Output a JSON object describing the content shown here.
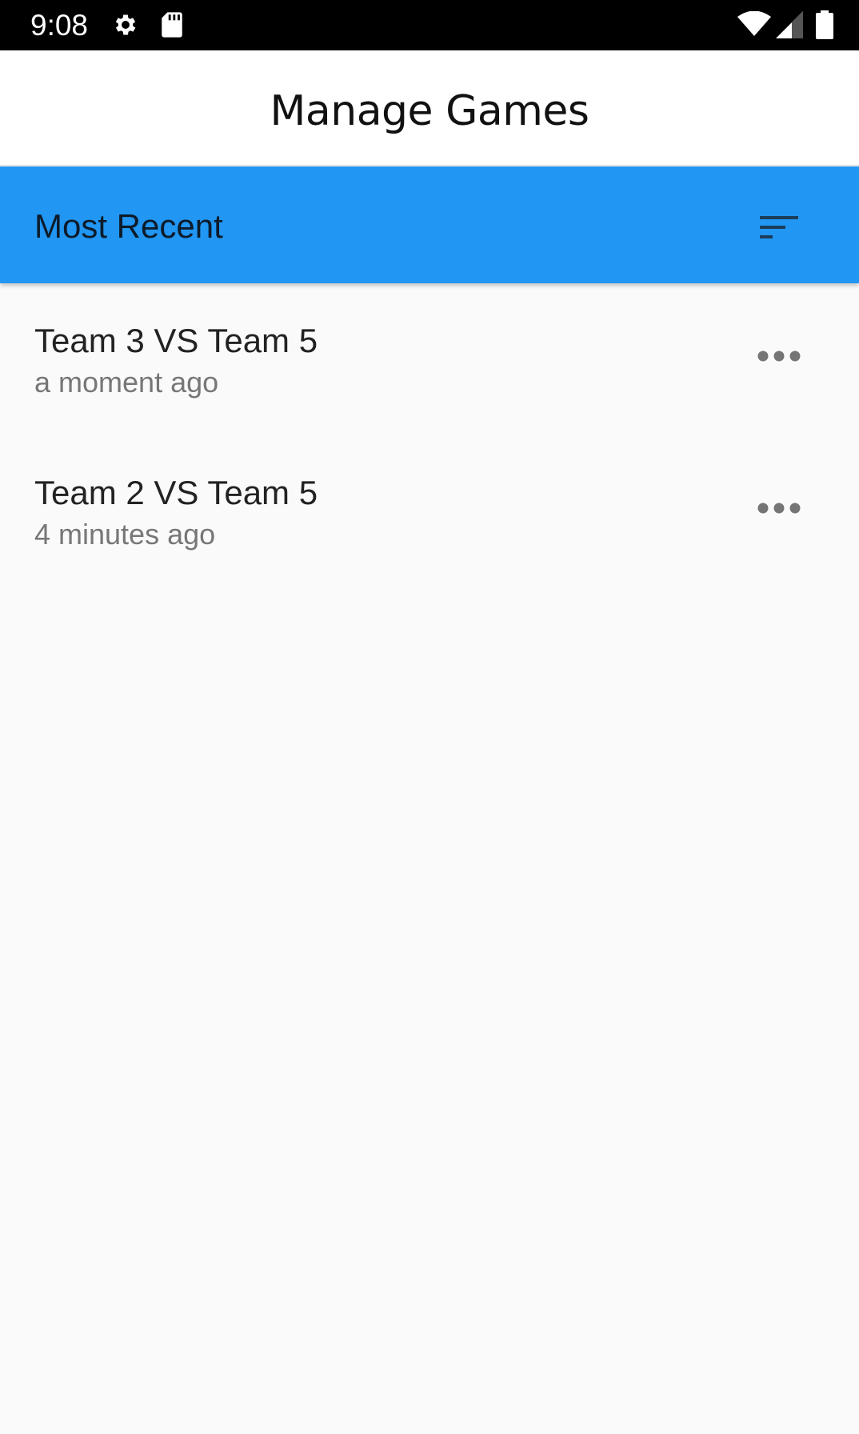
{
  "status_bar": {
    "time": "9:08",
    "icons": [
      "gear-icon",
      "sd-card-icon",
      "wifi-icon",
      "cell-signal-icon",
      "battery-icon"
    ]
  },
  "header": {
    "title": "Manage Games"
  },
  "sort_bar": {
    "label": "Most Recent",
    "icon": "sort-icon",
    "background": "#2196f3"
  },
  "games": [
    {
      "title": "Team 3 VS Team 5",
      "time": "a moment ago"
    },
    {
      "title": "Team 2 VS Team 5",
      "time": "4 minutes ago"
    }
  ]
}
